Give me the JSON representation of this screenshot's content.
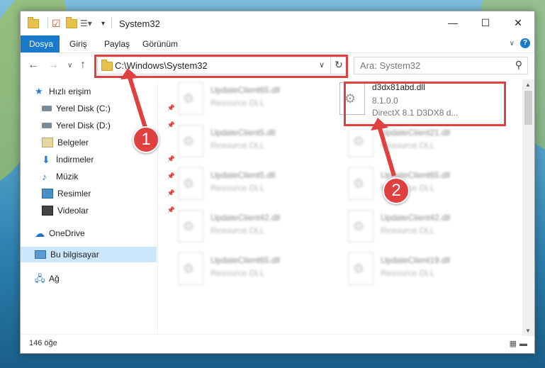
{
  "window": {
    "title": "System32",
    "controls": {
      "minimize": "—",
      "maximize": "☐",
      "close": "✕"
    }
  },
  "ribbon": {
    "tabs": [
      "Dosya",
      "Giriş",
      "Paylaş",
      "Görünüm"
    ],
    "active_tab": "Dosya",
    "help": "?"
  },
  "navigation": {
    "address": "C:\\Windows\\System32",
    "search_placeholder": "Ara: System32"
  },
  "sidebar": {
    "quick_access": "Hızlı erişim",
    "items": [
      {
        "label": "Yerel Disk (C:)",
        "icon": "drive-icon"
      },
      {
        "label": "Yerel Disk (D:)",
        "icon": "drive-icon"
      },
      {
        "label": "Belgeler",
        "icon": "documents-icon"
      },
      {
        "label": "İndirmeler",
        "icon": "download-icon"
      },
      {
        "label": "Müzik",
        "icon": "music-icon"
      },
      {
        "label": "Resimler",
        "icon": "pictures-icon"
      },
      {
        "label": "Videolar",
        "icon": "videos-icon"
      }
    ],
    "onedrive": "OneDrive",
    "this_pc": "Bu bilgisayar",
    "network": "Ağ"
  },
  "files": {
    "left_column": [
      {
        "name": "UpdateClient65.dll",
        "sub": "Resource DLL"
      },
      {
        "name": "UpdateClient5.dll",
        "sub": "Resource DLL"
      },
      {
        "name": "UpdateClient5.dll",
        "sub": "Resource DLL"
      },
      {
        "name": "UpdateClient42.dll",
        "sub": "Resource DLL"
      },
      {
        "name": "UpdateClient65.dll",
        "sub": "Resource DLL"
      }
    ],
    "highlighted": {
      "name": "d3dx81abd.dll",
      "version": "8.1.0.0",
      "description": "DirectX 8.1 D3DX8 d..."
    },
    "right_column": [
      {
        "name": "UpdateClient21.dll",
        "sub": "Resource DLL"
      },
      {
        "name": "UpdateClient65.dll",
        "sub": "Resource DLL"
      },
      {
        "name": "UpdateClient42.dll",
        "sub": "Resource DLL"
      },
      {
        "name": "UpdateClient19.dll",
        "sub": "Resource DLL"
      }
    ]
  },
  "status": {
    "count": "146 öğe"
  },
  "annotations": {
    "badge1": "1",
    "badge2": "2",
    "color": "#e0403f"
  },
  "colors": {
    "accent": "#1979ca",
    "selection": "#cce8ff"
  }
}
